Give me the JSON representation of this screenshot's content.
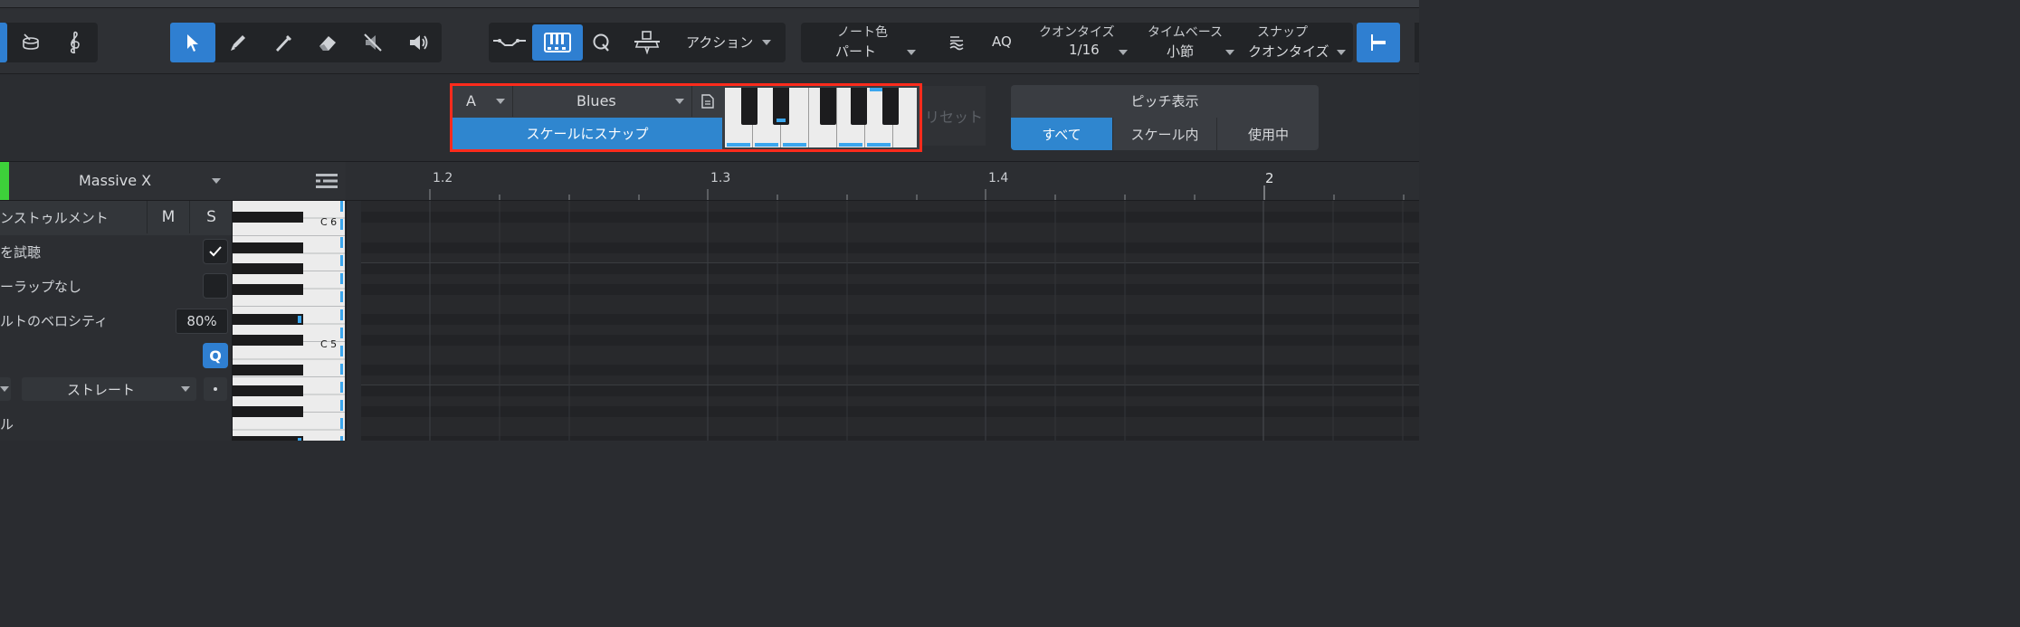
{
  "toolbar": {
    "tools": [
      {
        "id": "arrow",
        "icon": "arrow-tool-icon",
        "active": true
      },
      {
        "id": "pencil",
        "icon": "pencil-tool-icon"
      },
      {
        "id": "paint",
        "icon": "paint-tool-icon"
      },
      {
        "id": "eraser",
        "icon": "eraser-tool-icon"
      },
      {
        "id": "mute",
        "icon": "mute-tool-icon"
      },
      {
        "id": "listen",
        "icon": "speaker-tool-icon"
      }
    ],
    "action_label": "アクション",
    "note_color": {
      "label": "ノート色",
      "value": "パート"
    },
    "quantize": {
      "label": "クオンタイズ",
      "value": "1/16"
    },
    "aq_label": "AQ",
    "timebase": {
      "label": "タイムベース",
      "value": "小節"
    },
    "snap": {
      "label": "スナップ",
      "value": "クオンタイズ"
    }
  },
  "scale": {
    "root": "A",
    "scale_name": "Blues",
    "snap_label": "スケールにスナップ",
    "reset_label": "リセット"
  },
  "pitch_display": {
    "title": "ピッチ表示",
    "options": [
      "すべて",
      "スケール内",
      "使用中"
    ],
    "selected": "すべて"
  },
  "track": {
    "instrument": "Massive X"
  },
  "ruler": {
    "marks": [
      "1.2",
      "1.3",
      "1.4",
      "2"
    ]
  },
  "inspector": {
    "instrument_label": "ンストゥルメント",
    "m_label": "M",
    "s_label": "S",
    "audition_label": "を試聴",
    "overlap_label": "ーラップなし",
    "velocity_label": "ルトのベロシティ",
    "velocity_value": "80%",
    "q_label": "Q",
    "straight_label": "ストレート",
    "last_label": "ル"
  },
  "keyboard": {
    "c6_label": "C 6",
    "c5_label": "C 5"
  },
  "colors": {
    "accent": "#2f7fd1",
    "highlight": "#ff2b1c",
    "in_scale": "#3aa6ee"
  }
}
